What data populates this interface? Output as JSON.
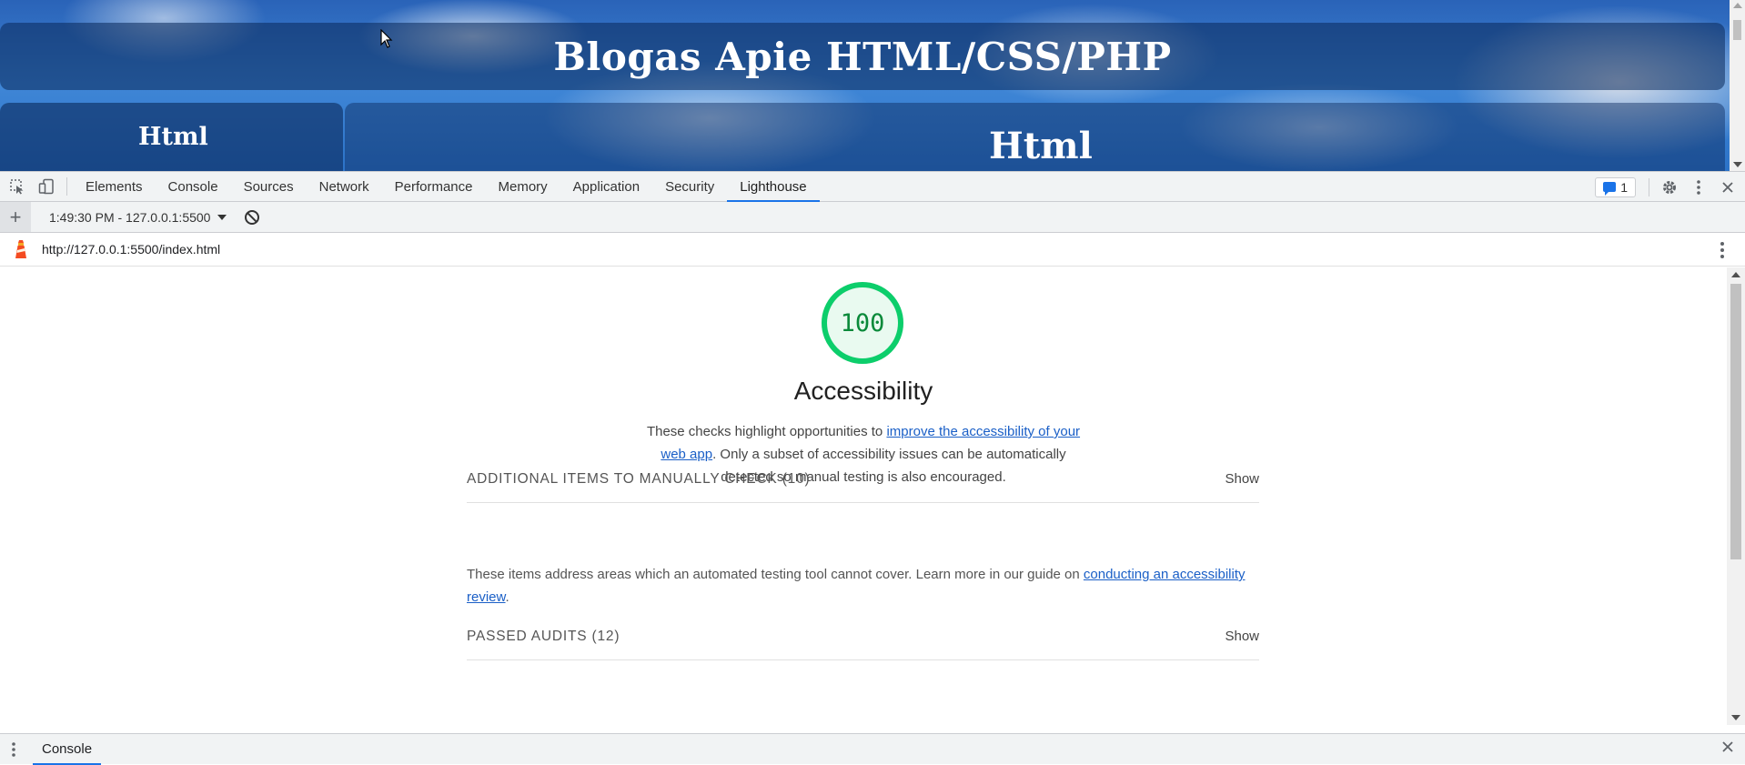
{
  "page": {
    "header_title": "Blogas Apie HTML/CSS/PHP",
    "sidebar_heading": "Html",
    "main_heading": "Html"
  },
  "devtools": {
    "tabs": [
      {
        "label": "Elements"
      },
      {
        "label": "Console"
      },
      {
        "label": "Sources"
      },
      {
        "label": "Network"
      },
      {
        "label": "Performance"
      },
      {
        "label": "Memory"
      },
      {
        "label": "Application"
      },
      {
        "label": "Security"
      },
      {
        "label": "Lighthouse",
        "active": true
      }
    ],
    "issues_count": "1",
    "accent_color": "#1a73e8"
  },
  "lighthouse": {
    "report_select": "1:49:30 PM - 127.0.0.1:5500",
    "url": "http://127.0.0.1:5500/index.html",
    "score": "100",
    "score_fraction": 1.0,
    "score_color": "#0cce6b",
    "category_title": "Accessibility",
    "desc_prefix": "These checks highlight opportunities to ",
    "desc_link": "improve the accessibility of your web app",
    "desc_suffix": ". Only a subset of accessibility issues can be automatically detected so manual testing is also encouraged.",
    "groups": {
      "manual": {
        "title": "ADDITIONAL ITEMS TO MANUALLY CHECK",
        "count": "(10)",
        "toggle": "Show"
      },
      "passed": {
        "title": "PASSED AUDITS",
        "count": "(12)",
        "toggle": "Show"
      }
    },
    "manual_desc_prefix": "These items address areas which an automated testing tool cannot cover. Learn more in our guide on ",
    "manual_desc_link": "conducting an accessibility review",
    "manual_desc_suffix": "."
  },
  "drawer": {
    "tab_label": "Console"
  }
}
